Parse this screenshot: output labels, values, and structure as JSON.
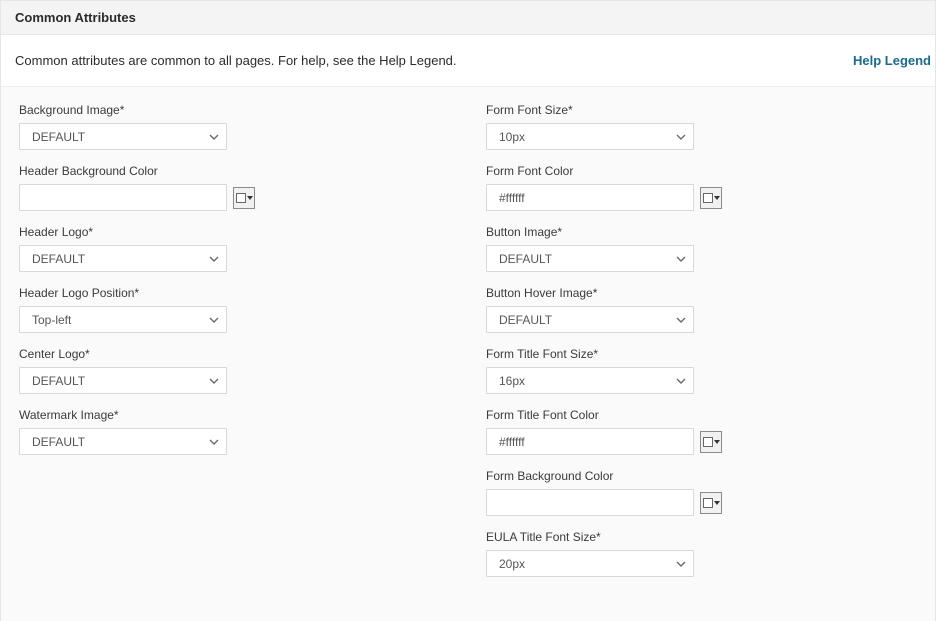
{
  "panel": {
    "title": "Common Attributes",
    "help_text": "Common attributes are common to all pages. For help, see the Help Legend.",
    "help_link": "Help Legend"
  },
  "left": {
    "background_image": {
      "label": "Background Image*",
      "value": "DEFAULT"
    },
    "header_bg_color": {
      "label": "Header Background Color",
      "value": ""
    },
    "header_logo": {
      "label": "Header Logo*",
      "value": "DEFAULT"
    },
    "header_logo_pos": {
      "label": "Header Logo Position*",
      "value": "Top-left"
    },
    "center_logo": {
      "label": "Center Logo*",
      "value": "DEFAULT"
    },
    "watermark_image": {
      "label": "Watermark Image*",
      "value": "DEFAULT"
    }
  },
  "right": {
    "form_font_size": {
      "label": "Form Font Size*",
      "value": "10px"
    },
    "form_font_color": {
      "label": "Form Font Color",
      "value": "#ffffff"
    },
    "button_image": {
      "label": "Button Image*",
      "value": "DEFAULT"
    },
    "button_hover_image": {
      "label": "Button Hover Image*",
      "value": "DEFAULT"
    },
    "form_title_font_size": {
      "label": "Form Title Font Size*",
      "value": "16px"
    },
    "form_title_font_color": {
      "label": "Form Title Font Color",
      "value": "#ffffff"
    },
    "form_bg_color": {
      "label": "Form Background Color",
      "value": ""
    },
    "eula_title_font_size": {
      "label": "EULA Title Font Size*",
      "value": "20px"
    }
  }
}
